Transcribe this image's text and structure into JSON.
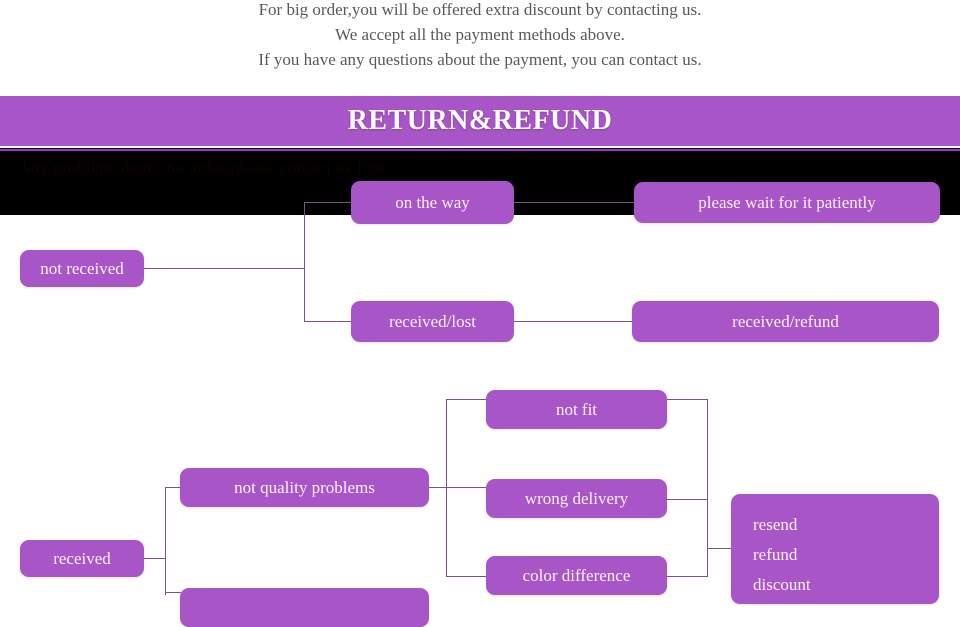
{
  "payment_note": {
    "lines": [
      "For big order,you will be offered extra discount by contacting us.",
      "We accept all the payment methods above.",
      "If you have any questions about the payment, you can contact us."
    ]
  },
  "banner": {
    "title": "RETURN&REFUND",
    "bg_color": "#a855c8",
    "text_color": "#ffffff",
    "underline_color": "#8c3fae"
  },
  "black_strip": {
    "obscured_text": "Any problem about the order,please contact us first",
    "bg_color": "#000000",
    "text_color": "#0d0109"
  },
  "flowchart": {
    "node_color": "#a855c8",
    "node_text_color": "#fdf2fb",
    "connector_color": "#7a567f",
    "nodes": [
      {
        "id": "not-received",
        "label": "not received"
      },
      {
        "id": "on-the-way",
        "label": "on the way"
      },
      {
        "id": "please-wait",
        "label": "please wait for it patiently"
      },
      {
        "id": "received-lost",
        "label": "received/lost"
      },
      {
        "id": "received-refund",
        "label": "received/refund"
      },
      {
        "id": "received",
        "label": "received"
      },
      {
        "id": "not-quality-problems",
        "label": "not quality problems"
      },
      {
        "id": "not-fit",
        "label": "not fit"
      },
      {
        "id": "wrong-delivery",
        "label": "wrong delivery"
      },
      {
        "id": "color-difference",
        "label": "color difference"
      },
      {
        "id": "quality-problems",
        "label": ""
      }
    ],
    "outcome": {
      "id": "resend-refund-discount",
      "lines": [
        "resend",
        "refund",
        "discount"
      ]
    }
  }
}
